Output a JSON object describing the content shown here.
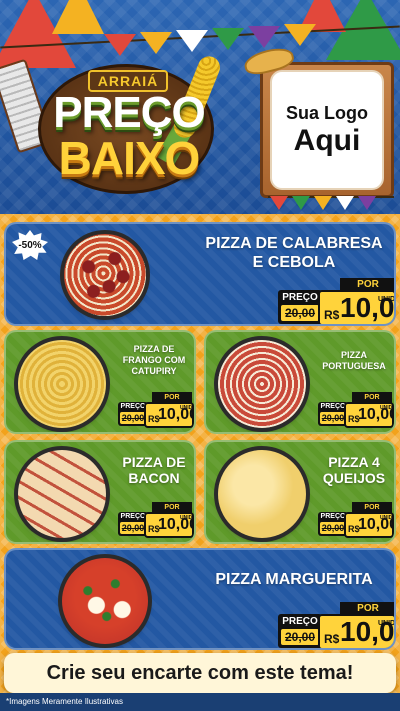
{
  "header": {
    "arraia": "ARRAIÁ",
    "headline_1": "PREÇO",
    "headline_2": "BAIXO",
    "logo_line_1": "Sua Logo",
    "logo_line_2": "Aqui"
  },
  "products": [
    {
      "name_line_1": "PIZZA DE CALABRESA",
      "name_line_2": "E CEBOLA",
      "badge": "-50%",
      "old_label": "PREÇO",
      "old_price": "20,00",
      "por": "POR",
      "currency": "R$",
      "price": "10,00",
      "unit": "UNID"
    },
    {
      "name_line_1": "PIZZA DE",
      "name_line_2": "FRANGO COM",
      "name_line_3": "CATUPIRY",
      "old_label": "PREÇO",
      "old_price": "20,00",
      "por": "POR",
      "currency": "R$",
      "price": "10,00",
      "unit": "UNID"
    },
    {
      "name_line_1": "PIZZA",
      "name_line_2": "PORTUGUESA",
      "old_label": "PREÇO",
      "old_price": "20,00",
      "por": "POR",
      "currency": "R$",
      "price": "10,00",
      "unit": "UNID"
    },
    {
      "name_line_1": "PIZZA DE",
      "name_line_2": "BACON",
      "old_label": "PREÇO",
      "old_price": "20,00",
      "por": "POR",
      "currency": "R$",
      "price": "10,00",
      "unit": "UNID"
    },
    {
      "name_line_1": "PIZZA 4",
      "name_line_2": "QUEIJOS",
      "old_label": "PREÇO",
      "old_price": "20,00",
      "por": "POR",
      "currency": "R$",
      "price": "10,00",
      "unit": "UNID"
    },
    {
      "name_line_1": "PIZZA MARGUERITA",
      "old_label": "PREÇO",
      "old_price": "20,00",
      "por": "POR",
      "currency": "R$",
      "price": "10,00",
      "unit": "UNID"
    }
  ],
  "cta": "Crie seu encarte com este tema!",
  "footer_note": "*Imagens Meramente Ilustrativas",
  "colors": {
    "header_blue": "#2c66b3",
    "card_blue": "#2358a3",
    "card_green": "#5f9a2a",
    "background_orange": "#f2a21c",
    "price_yellow": "#ffd33b"
  }
}
